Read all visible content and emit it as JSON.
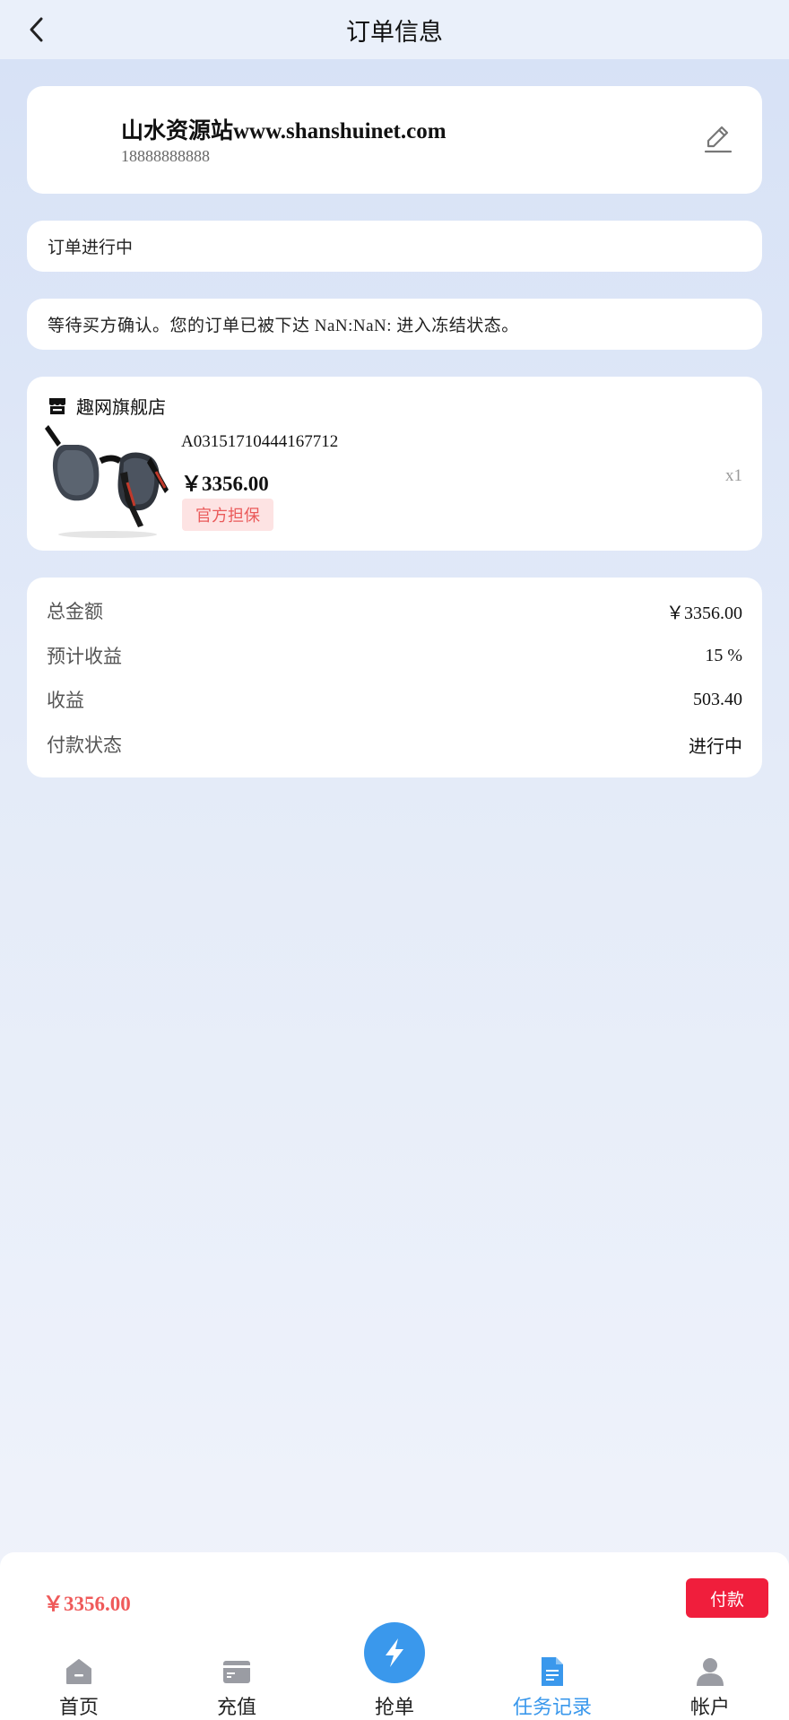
{
  "header": {
    "title": "订单信息",
    "back_icon": "chevron-left-icon"
  },
  "user": {
    "name": "山水资源站www.shanshuinet.com",
    "phone": "18888888888",
    "edit_icon": "edit-pencil-icon"
  },
  "order_status": {
    "text": "订单进行中"
  },
  "notice": {
    "text": "等待买方确认。您的订单已被下达 NaN:NaN: 进入冻结状态。"
  },
  "product": {
    "shop_icon": "store-icon",
    "shop_name": "趣网旗舰店",
    "image": "sunglasses",
    "code": "A03151710444167712",
    "price": "￥3356.00",
    "badge": "官方担保",
    "quantity": "x1"
  },
  "summary": {
    "rows": [
      {
        "label": "总金额",
        "value": "￥3356.00"
      },
      {
        "label": "预计收益",
        "value": "15 %"
      },
      {
        "label": "收益",
        "value": "503.40"
      },
      {
        "label": "付款状态",
        "value": "进行中"
      }
    ]
  },
  "pay_bar": {
    "total": "￥3356.00",
    "pay_label": "付款"
  },
  "tabbar": {
    "active_index": 3,
    "active_color": "#3a98ec",
    "items": [
      {
        "label": "首页",
        "icon": "home-icon"
      },
      {
        "label": "充值",
        "icon": "wallet-icon"
      },
      {
        "label": "抢单",
        "icon": "lightning-icon"
      },
      {
        "label": "任务记录",
        "icon": "document-icon"
      },
      {
        "label": "帐户",
        "icon": "user-icon"
      }
    ]
  }
}
